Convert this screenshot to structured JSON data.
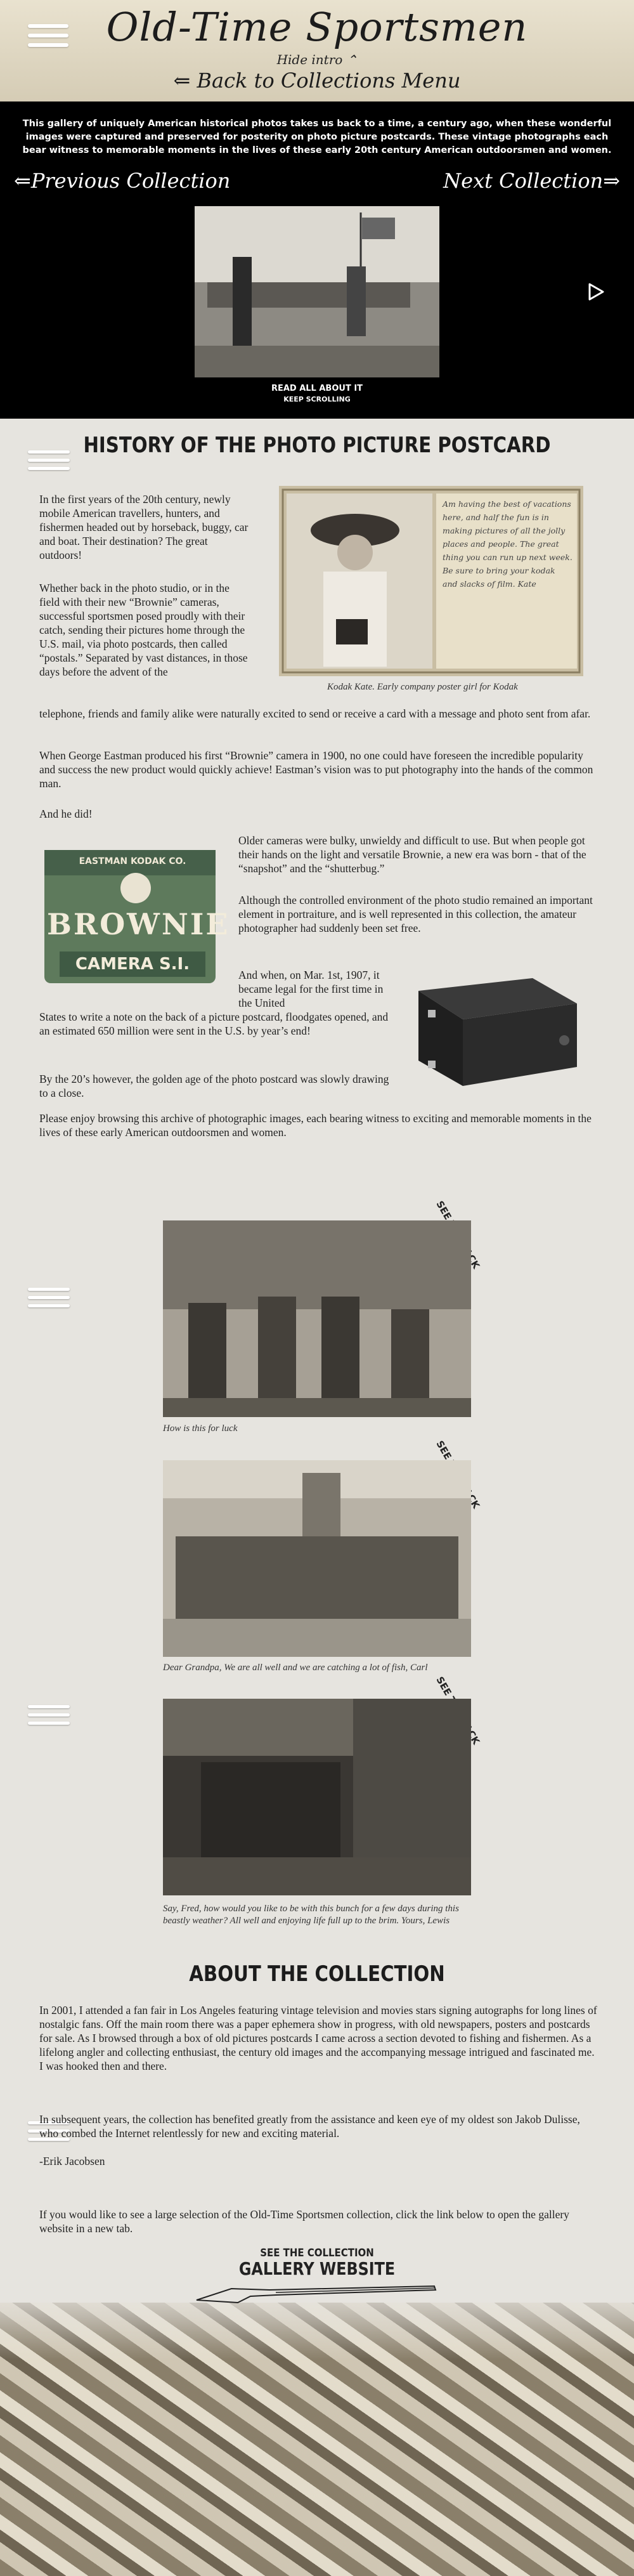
{
  "header": {
    "title": "Old-Time Sportsmen",
    "hide_intro": "Hide intro ⌃",
    "back_link": "Back to Collections Menu"
  },
  "intro": {
    "text": "This gallery of uniquely American historical photos takes us back to a time, a century ago, when these wonderful images were captured and preserved for posterity on photo picture postcards. These vintage photographs each bear witness to memorable moments in the lives of these early 20th century American outdoorsmen and women.",
    "prev": "Previous Collection",
    "next": "Next Collection",
    "read_all": "READ ALL ABOUT IT",
    "keep_scrolling": "KEEP SCROLLING"
  },
  "history": {
    "title": "HISTORY OF THE PHOTO PICTURE POSTCARD",
    "p1": "In the first years of the 20th century, newly mobile American travellers, hunters, and fishermen headed out by horseback, buggy, car and boat. Their destination? The great outdoors!",
    "p2": "Whether back in the photo studio, or in the field with their new “Brownie” cameras, successful sportsmen posed proudly with their catch, sending their pictures home through the U.S. mail, via photo postcards, then called “postals.” Separated by vast distances, in those days before the advent of the telephone, friends and family alike were naturally excited to send or receive a card with a message and photo sent from afar.",
    "kodak_caption": "Kodak Kate. Early company poster girl for Kodak",
    "kodak_script": "Am having the best of vacations here, and half the fun is in making pictures of all the jolly places and people. The great thing you can run up next week. Be sure to bring your kodak and slacks of film.   Kate",
    "p3": "When George Eastman produced his first “Brownie” camera in 1900, no one could have foreseen the incredible popularity and success the new product would quickly achieve! Eastman’s vision was to put photography into the hands of the common man.",
    "p4": "And he did!",
    "p5": "Older cameras were bulky, unwieldy and difficult to use. But when people got their hands on the light and versatile Brownie, a new era was born - that of the “snapshot” and the “shutterbug.”",
    "p6": "Although the controlled environment of the photo studio remained an important element in portraiture, and is well represented in this collection, the amateur photographer had suddenly been set free.",
    "p7": "And when, on Mar. 1st, 1907, it became legal for the first time in the United States to write a note on the back of a picture postcard, floodgates opened, and an estimated 650 million were sent in the U.S. by year’s end!",
    "p8": "By the 20’s however, the golden age of the photo postcard was slowly drawing to a close.",
    "p9": "Please enjoy browsing this archive of photographic images, each bearing witness to exciting and memorable moments in the lives of these early American outdoorsmen and women.",
    "brownie_box_top": "EASTMAN KODAK CO.",
    "brownie_box_mid": "BROWNIE",
    "brownie_box_bottom": "CAMERA S.I."
  },
  "gallery": [
    {
      "see_back": "SEE THE BACK",
      "caption": "How is this for luck"
    },
    {
      "see_back": "SEE THE BACK",
      "caption": "Dear Grandpa, We are all well and we are catching a lot of fish, Carl"
    },
    {
      "see_back": "SEE THE BACK",
      "caption": "Say, Fred, how would you like to be with this bunch for a few days during this beastly weather? All well and enjoying life full up to the brim. Yours, Lewis"
    }
  ],
  "about": {
    "title": "ABOUT THE COLLECTION",
    "p1": "In 2001, I attended a fan fair in Los Angeles featuring vintage television and movies stars signing autographs for long lines of nostalgic fans. Off the main room there was a paper ephemera show in progress, with old newspapers, posters and postcards for sale. As I browsed through a box of old pictures postcards I came across a section devoted to fishing and fishermen. As a lifelong angler and collecting enthusiast, the century old images and the accompanying message intrigued and fascinated me. I was hooked then and there.",
    "p2": "In subsequent years, the collection has benefited greatly from the assistance and keen eye of my oldest son Jakob Dulisse, who combed the Internet relentlessly for new and exciting material.",
    "signature": "-Erik Jacobsen",
    "p3": "If you would like to see a large selection of the Old-Time Sportsmen collection, click the link below to open the gallery website in a new tab.",
    "link_small": "SEE THE COLLECTION",
    "link_big": "GALLERY WEBSITE"
  },
  "colors": {
    "background": "#e6e4df",
    "intro_bg": "#000000",
    "text": "#222222"
  }
}
